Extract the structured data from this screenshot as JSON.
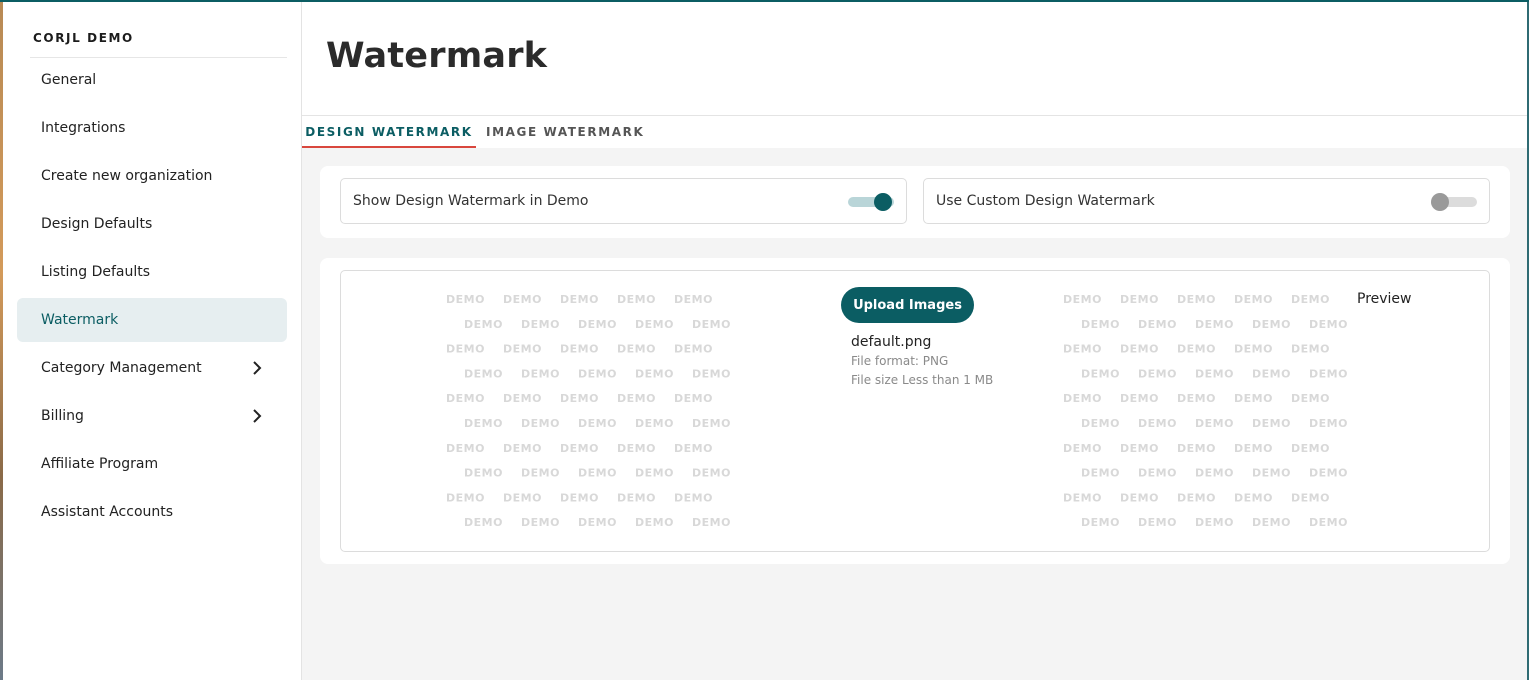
{
  "brand": "CORJL DEMO",
  "sidebar": {
    "items": [
      {
        "label": "General"
      },
      {
        "label": "Integrations"
      },
      {
        "label": "Create new organization"
      },
      {
        "label": "Design Defaults"
      },
      {
        "label": "Listing Defaults"
      },
      {
        "label": "Watermark",
        "active": true
      },
      {
        "label": "Category Management",
        "icon": "chevron-right-icon"
      },
      {
        "label": "Billing",
        "icon": "chevron-right-icon"
      },
      {
        "label": "Affiliate Program"
      },
      {
        "label": "Assistant Accounts"
      }
    ]
  },
  "header": {
    "title": "Watermark"
  },
  "tabs": [
    {
      "label": "DESIGN WATERMARK",
      "active": true
    },
    {
      "label": "IMAGE WATERMARK",
      "active": false
    }
  ],
  "settings": {
    "show_design_watermark": {
      "label": "Show Design Watermark in Demo",
      "enabled": true
    },
    "use_custom_watermark": {
      "label": "Use Custom Design Watermark",
      "enabled": false
    }
  },
  "upload": {
    "button_label": "Upload Images",
    "filename": "default.png",
    "format": "File format: PNG",
    "size": "File size Less than 1 MB"
  },
  "preview_label": "Preview",
  "watermark_text": "DEMO",
  "colors": {
    "accent": "#0b5d63",
    "tab_underline": "#d9473e",
    "active_nav_bg": "#e6eef0"
  }
}
